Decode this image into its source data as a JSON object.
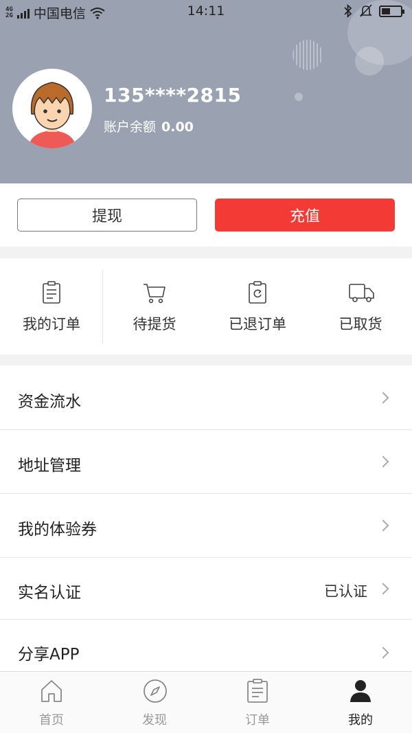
{
  "status_bar": {
    "network_type": "4G\n2G",
    "carrier": "中国电信",
    "time": "14:11",
    "battery_level_percent": 45
  },
  "profile": {
    "phone": "135****2815",
    "balance_label": "账户余额",
    "balance_value": "0.00"
  },
  "actions": {
    "withdraw_label": "提现",
    "recharge_label": "充值",
    "recharge_color": "#f33a35"
  },
  "orders": [
    {
      "label": "我的订单",
      "icon": "clipboard-icon"
    },
    {
      "label": "待提货",
      "icon": "cart-icon"
    },
    {
      "label": "已退订单",
      "icon": "refund-icon"
    },
    {
      "label": "已取货",
      "icon": "truck-icon"
    }
  ],
  "menu": [
    {
      "label": "资金流水",
      "value": ""
    },
    {
      "label": "地址管理",
      "value": ""
    },
    {
      "label": "我的体验券",
      "value": ""
    },
    {
      "label": "实名认证",
      "value": "已认证"
    },
    {
      "label": "分享APP",
      "value": ""
    }
  ],
  "tabs": [
    {
      "label": "首页",
      "icon": "home-icon",
      "active": false
    },
    {
      "label": "发现",
      "icon": "compass-icon",
      "active": false
    },
    {
      "label": "订单",
      "icon": "order-list-icon",
      "active": false
    },
    {
      "label": "我的",
      "icon": "user-icon",
      "active": true
    }
  ]
}
